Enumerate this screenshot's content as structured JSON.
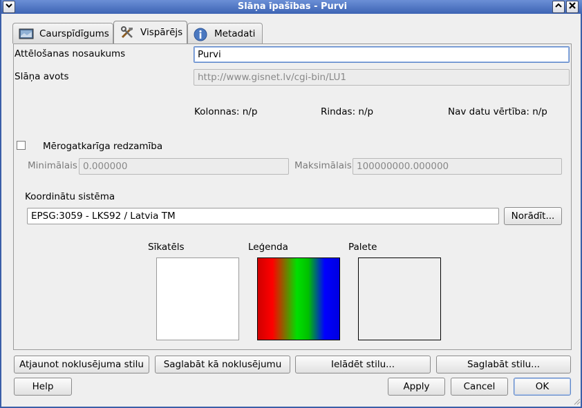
{
  "window": {
    "title": "Slāņa īpašības - Purvi",
    "menu_icon": "chevron-down-icon",
    "minimize_icon": "chevron-up-icon",
    "close_icon": "close-icon"
  },
  "tabs": [
    {
      "label": "Caurspīdīgums",
      "icon": "transparency-icon",
      "active": false
    },
    {
      "label": "Vispārējs",
      "icon": "tools-icon",
      "active": true
    },
    {
      "label": "Metadati",
      "icon": "info-icon",
      "active": false
    }
  ],
  "general": {
    "display_name_label": "Attēlošanas nosaukums",
    "display_name_value": "Purvi",
    "layer_source_label": "Slāņa avots",
    "layer_source_value": "http://www.gisnet.lv/cgi-bin/LU1",
    "columns": "Kolonnas: n/p",
    "rows": "Rindas: n/p",
    "nodata": "Nav datu vērtība: n/p"
  },
  "scale": {
    "checkbox_label": "Mērogatkarīga redzamība",
    "checked": false,
    "min_label": "Minimālais",
    "min_value": "0.000000",
    "max_label": "Maksimālais",
    "max_value": "100000000.000000"
  },
  "crs": {
    "label": "Koordinātu sistēma",
    "value": "EPSG:3059 - LKS92 / Latvia TM",
    "button": "Norādīt..."
  },
  "previews": {
    "thumbnail_label": "Sīkatēls",
    "legend_label": "Leģenda",
    "palette_label": "Palete"
  },
  "style_buttons": {
    "restore": "Atjaunot noklusējuma stilu",
    "save_default": "Saglabāt kā noklusējumu",
    "load": "Ielādēt stilu...",
    "save": "Saglabāt stilu..."
  },
  "dialog_buttons": {
    "help": "Help",
    "apply": "Apply",
    "cancel": "Cancel",
    "ok": "OK"
  },
  "colors": {
    "titlebar": "#3d64b4",
    "focus": "#5d86c8"
  }
}
